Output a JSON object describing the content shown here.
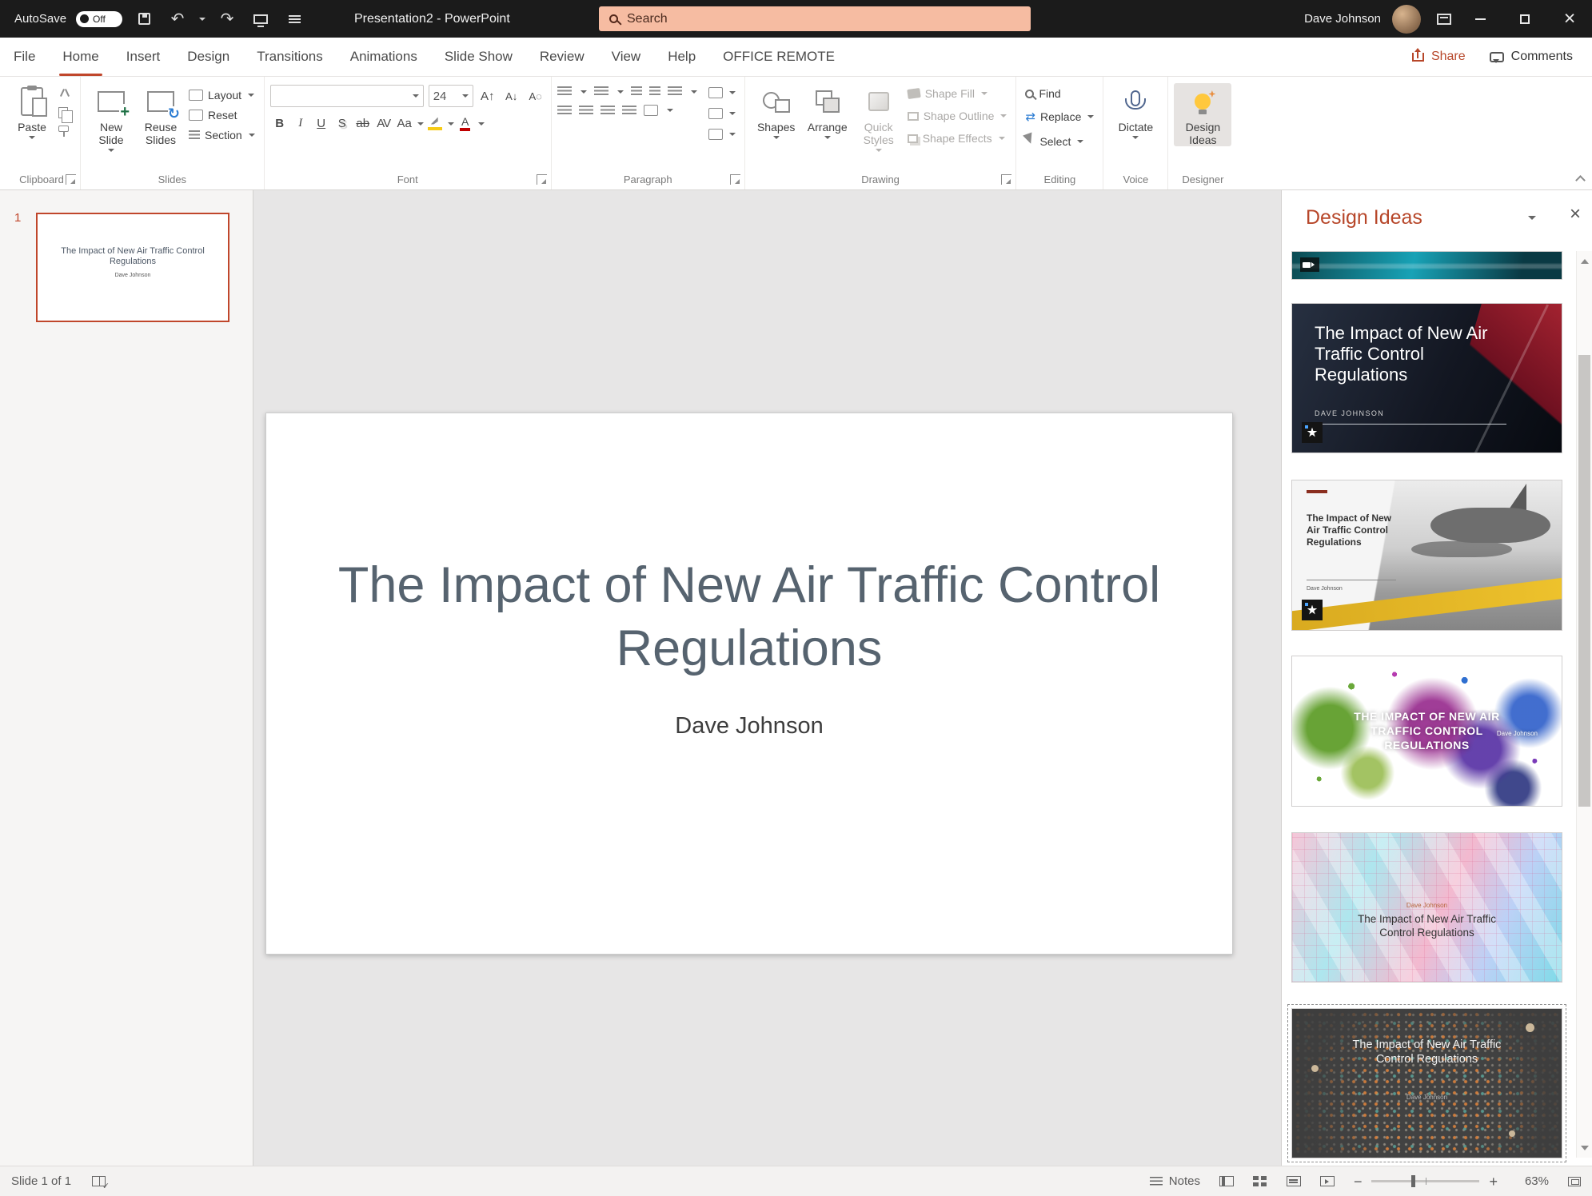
{
  "colors": {
    "accent": "#C0462B",
    "titlebar_bg": "#1B1B1B",
    "search_bg": "#F6BCA2"
  },
  "titlebar": {
    "autosave_label": "AutoSave",
    "autosave_state": "Off",
    "app_title": "Presentation2  -  PowerPoint",
    "search_placeholder": "Search",
    "user_name": "Dave Johnson"
  },
  "ribbon": {
    "tabs": [
      "File",
      "Home",
      "Insert",
      "Design",
      "Transitions",
      "Animations",
      "Slide Show",
      "Review",
      "View",
      "Help",
      "OFFICE REMOTE"
    ],
    "active_tab": "Home",
    "share_label": "Share",
    "comments_label": "Comments",
    "clipboard": {
      "group_label": "Clipboard",
      "paste_label": "Paste"
    },
    "slides": {
      "group_label": "Slides",
      "new_slide_label": "New Slide",
      "reuse_slides_label": "Reuse Slides",
      "layout_label": "Layout",
      "reset_label": "Reset",
      "section_label": "Section"
    },
    "font": {
      "group_label": "Font",
      "font_size_value": "24"
    },
    "paragraph": {
      "group_label": "Paragraph"
    },
    "drawing": {
      "group_label": "Drawing",
      "shapes_label": "Shapes",
      "arrange_label": "Arrange",
      "quick_styles_label": "Quick Styles",
      "shape_fill_label": "Shape Fill",
      "shape_outline_label": "Shape Outline",
      "shape_effects_label": "Shape Effects"
    },
    "editing": {
      "group_label": "Editing",
      "find_label": "Find",
      "replace_label": "Replace",
      "select_label": "Select"
    },
    "voice": {
      "group_label": "Voice",
      "dictate_label": "Dictate"
    },
    "designer": {
      "group_label": "Designer",
      "design_ideas_label": "Design Ideas"
    }
  },
  "slide_panel": {
    "slide_number": "1"
  },
  "slide": {
    "title": "The Impact of New Air Traffic Control Regulations",
    "subtitle": "Dave Johnson"
  },
  "design_pane": {
    "title": "Design Ideas",
    "slide_title": "The Impact of New Air Traffic Control Regulations",
    "slide_title_upper": "THE IMPACT OF NEW AIR TRAFFIC CONTROL REGULATIONS",
    "author": "Dave Johnson",
    "author_upper": "DAVE JOHNSON"
  },
  "statusbar": {
    "slide_info": "Slide 1 of 1",
    "notes_label": "Notes",
    "zoom_level": "63%"
  }
}
